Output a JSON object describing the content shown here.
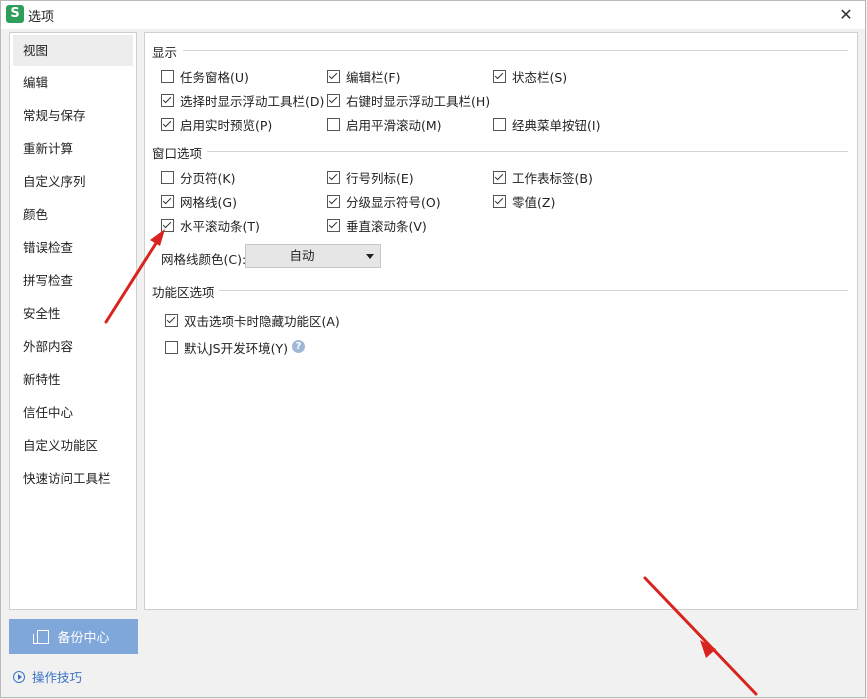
{
  "window": {
    "app_icon_letter": "S",
    "title": "选项",
    "close_glyph": "✕"
  },
  "sidebar": {
    "items": [
      {
        "label": "视图",
        "active": true
      },
      {
        "label": "编辑"
      },
      {
        "label": "常规与保存"
      },
      {
        "label": "重新计算"
      },
      {
        "label": "自定义序列"
      },
      {
        "label": "颜色"
      },
      {
        "label": "错误检查"
      },
      {
        "label": "拼写检查"
      },
      {
        "label": "安全性"
      },
      {
        "label": "外部内容"
      },
      {
        "label": "新特性"
      },
      {
        "label": "信任中心"
      },
      {
        "label": "自定义功能区"
      },
      {
        "label": "快速访问工具栏"
      }
    ]
  },
  "display": {
    "title": "显示",
    "options": [
      {
        "label": "任务窗格(U)",
        "checked": false
      },
      {
        "label": "编辑栏(F)",
        "checked": true
      },
      {
        "label": "状态栏(S)",
        "checked": true
      },
      {
        "label": "选择时显示浮动工具栏(D)",
        "checked": true
      },
      {
        "label": "右键时显示浮动工具栏(H)",
        "checked": true
      },
      {
        "label": "启用实时预览(P)",
        "checked": true
      },
      {
        "label": "启用平滑滚动(M)",
        "checked": false
      },
      {
        "label": "经典菜单按钮(I)",
        "checked": false
      }
    ]
  },
  "window_options": {
    "title": "窗口选项",
    "options": [
      {
        "label": "分页符(K)",
        "checked": false
      },
      {
        "label": "行号列标(E)",
        "checked": true
      },
      {
        "label": "工作表标签(B)",
        "checked": true
      },
      {
        "label": "网格线(G)",
        "checked": true
      },
      {
        "label": "分级显示符号(O)",
        "checked": true
      },
      {
        "label": "零值(Z)",
        "checked": true
      },
      {
        "label": "水平滚动条(T)",
        "checked": true
      },
      {
        "label": "垂直滚动条(V)",
        "checked": true
      }
    ],
    "gridline_color_label": "网格线颜色(C):",
    "gridline_color_value": "自动"
  },
  "ribbon": {
    "title": "功能区选项",
    "options": [
      {
        "label": "双击选项卡时隐藏功能区(A)",
        "checked": true
      },
      {
        "label": "默认JS开发环境(Y)",
        "checked": false
      }
    ],
    "help_glyph": "?"
  },
  "footer": {
    "backup_label": "备份中心",
    "tips_label": "操作技巧"
  },
  "colors": {
    "accent_button": "#7fa7d9",
    "link": "#3b73c4",
    "annotation_arrow": "#d8231f"
  },
  "icons": {
    "app": "wps-spreadsheet-icon",
    "close": "close-icon",
    "backup": "backup-icon",
    "tips": "play-circle-icon",
    "help": "help-icon",
    "dropdown": "chevron-down-icon"
  }
}
